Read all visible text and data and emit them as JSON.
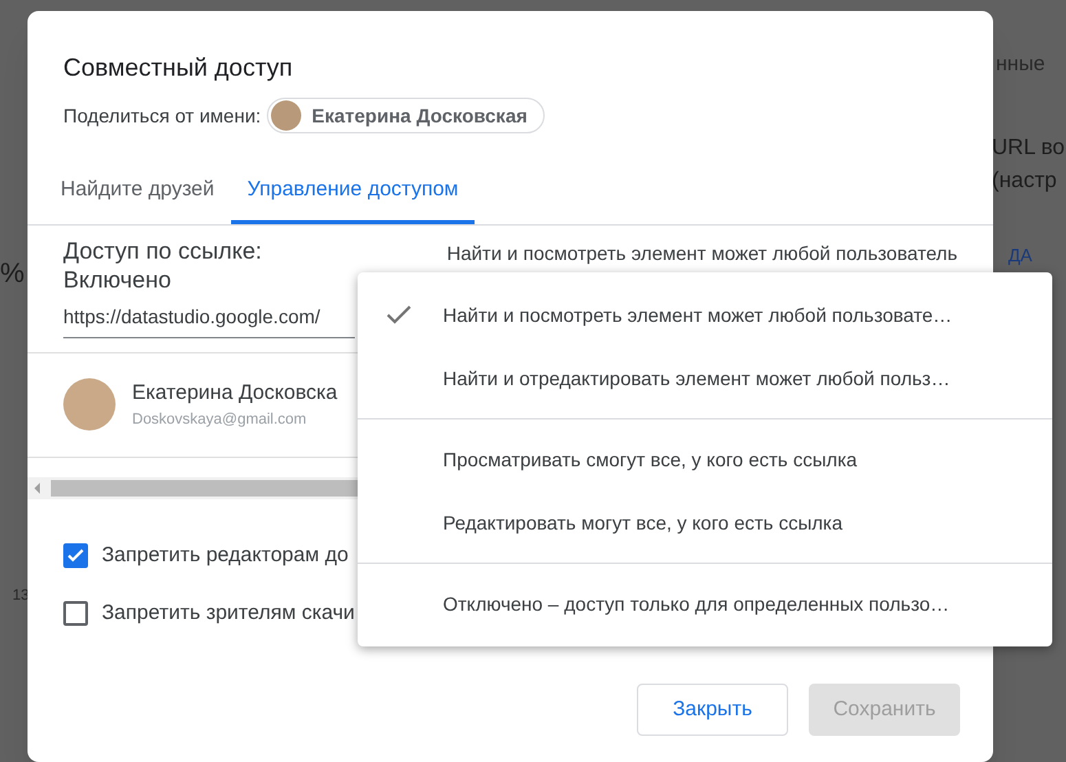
{
  "background_app": {
    "fragments": [
      {
        "kind": "tab",
        "text": "нные"
      },
      {
        "kind": "heading",
        "text": "URL во"
      },
      {
        "kind": "heading",
        "text": "(настр"
      },
      {
        "kind": "link",
        "text": "ДА"
      },
      {
        "kind": "big",
        "text": "%"
      },
      {
        "kind": "axis",
        "text": "13"
      }
    ]
  },
  "dialog": {
    "title": "Совместный доступ",
    "share_as_label": "Поделиться от имени:",
    "share_as_name": "Екатерина Досковская",
    "tabs": [
      {
        "label": "Найдите друзей",
        "selected": false
      },
      {
        "label": "Управление доступом",
        "selected": true
      }
    ],
    "link_access_label": "Доступ по ссылке:",
    "link_access_state": "Включено",
    "link_access_value": "Найти и посмотреть элемент может любой пользователь",
    "url": "https://datastudio.google.com/",
    "person": {
      "name": "Екатерина Досковска",
      "email": "Doskovskaya@gmail.com"
    },
    "options": [
      {
        "label": "Запретить редакторам до",
        "checked": true
      },
      {
        "label": "Запретить зрителям скачи",
        "checked": false
      }
    ],
    "buttons": [
      {
        "label": "Закрыть",
        "disabled": false
      },
      {
        "label": "Сохранить",
        "disabled": true
      }
    ]
  },
  "menu": {
    "groups": [
      [
        {
          "label": "Найти и посмотреть элемент может любой пользовате…",
          "selected": true
        },
        {
          "label": "Найти и отредактировать элемент может любой польз…",
          "selected": false
        }
      ],
      [
        {
          "label": "Просматривать смогут все, у кого есть ссылка",
          "selected": false
        },
        {
          "label": "Редактировать могут все, у кого есть ссылка",
          "selected": false
        }
      ],
      [
        {
          "label": "Отключено – доступ только для определенных пользо…",
          "selected": false
        }
      ]
    ]
  }
}
